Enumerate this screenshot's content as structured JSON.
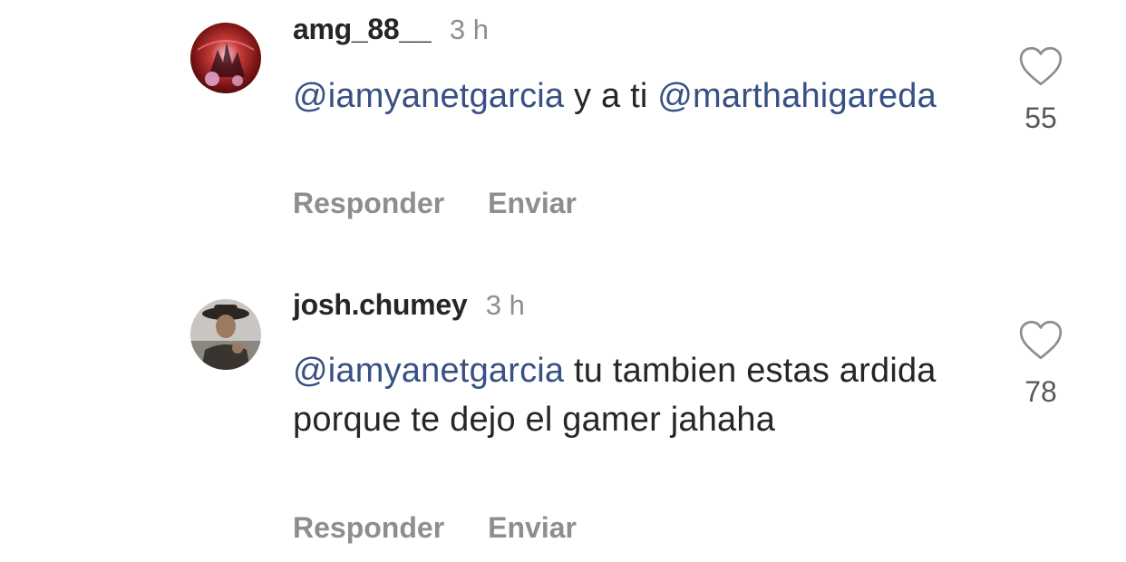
{
  "comments": [
    {
      "username": "amg_88__",
      "time": "3 h",
      "mention": "@iamyanetgarcia",
      "text": " y a ti ",
      "mention2": "@marthahigareda",
      "reply_label": "Responder",
      "send_label": "Enviar",
      "likes": "55"
    },
    {
      "username": "josh.chumey",
      "time": "3 h",
      "mention": "@iamyanetgarcia",
      "text": " tu tambien estas ardida porque te dejo el gamer jahaha",
      "reply_label": "Responder",
      "send_label": "Enviar",
      "likes": "78"
    }
  ],
  "colors": {
    "mention": "#385185",
    "secondary_text": "#8e8e8e",
    "primary_text": "#262626"
  },
  "icons": {
    "like": "heart-outline-icon"
  }
}
